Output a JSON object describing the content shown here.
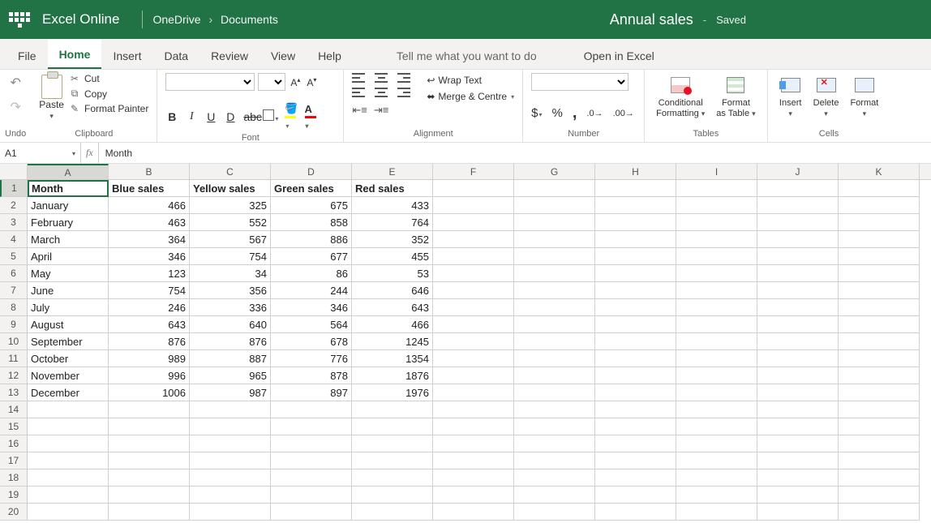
{
  "titlebar": {
    "app_name": "Excel Online",
    "breadcrumb": [
      "OneDrive",
      "Documents"
    ],
    "doc_title": "Annual sales",
    "save_status": "Saved"
  },
  "tabs": {
    "items": [
      "File",
      "Home",
      "Insert",
      "Data",
      "Review",
      "View",
      "Help"
    ],
    "active": "Home",
    "tell_me": "Tell me what you want to do",
    "open_in": "Open in Excel"
  },
  "qat": {
    "undo_label": "Undo"
  },
  "ribbon": {
    "clipboard": {
      "label": "Clipboard",
      "paste": "Paste",
      "cut": "Cut",
      "copy": "Copy",
      "painter": "Format Painter"
    },
    "font": {
      "label": "Font",
      "family": "",
      "size": "",
      "grow": "A",
      "shrink": "A",
      "bold": "B",
      "italic": "I",
      "underline": "U",
      "double_u": "D",
      "strike": "abc"
    },
    "alignment": {
      "label": "Alignment",
      "wrap": "Wrap Text",
      "merge": "Merge & Centre"
    },
    "number": {
      "label": "Number",
      "format": "",
      "currency": "$",
      "percent": "%",
      "comma": ",",
      "inc_dec": "⁰₀←",
      "dec_dec": "⁰₀→"
    },
    "tables": {
      "label": "Tables",
      "cond_fmt_l1": "Conditional",
      "cond_fmt_l2": "Formatting",
      "as_table_l1": "Format",
      "as_table_l2": "as Table"
    },
    "cells": {
      "label": "Cells",
      "insert": "Insert",
      "delete": "Delete",
      "format": "Format"
    }
  },
  "fx": {
    "namebox": "A1",
    "formula": "Month"
  },
  "sheet": {
    "cols": [
      "A",
      "B",
      "C",
      "D",
      "E",
      "F",
      "G",
      "H",
      "I",
      "J",
      "K"
    ],
    "active_cell": "A1",
    "header_row": [
      "Month",
      "Blue sales",
      "Yellow sales",
      "Green sales",
      "Red sales",
      "",
      "",
      "",
      "",
      "",
      ""
    ],
    "data": [
      [
        "January",
        "466",
        "325",
        "675",
        "433"
      ],
      [
        "February",
        "463",
        "552",
        "858",
        "764"
      ],
      [
        "March",
        "364",
        "567",
        "886",
        "352"
      ],
      [
        "April",
        "346",
        "754",
        "677",
        "455"
      ],
      [
        "May",
        "123",
        "34",
        "86",
        "53"
      ],
      [
        "June",
        "754",
        "356",
        "244",
        "646"
      ],
      [
        "July",
        "246",
        "336",
        "346",
        "643"
      ],
      [
        "August",
        "643",
        "640",
        "564",
        "466"
      ],
      [
        "September",
        "876",
        "876",
        "678",
        "1245"
      ],
      [
        "October",
        "989",
        "887",
        "776",
        "1354"
      ],
      [
        "November",
        "996",
        "965",
        "878",
        "1876"
      ],
      [
        "December",
        "1006",
        "987",
        "897",
        "1976"
      ]
    ],
    "total_rows": 20
  }
}
